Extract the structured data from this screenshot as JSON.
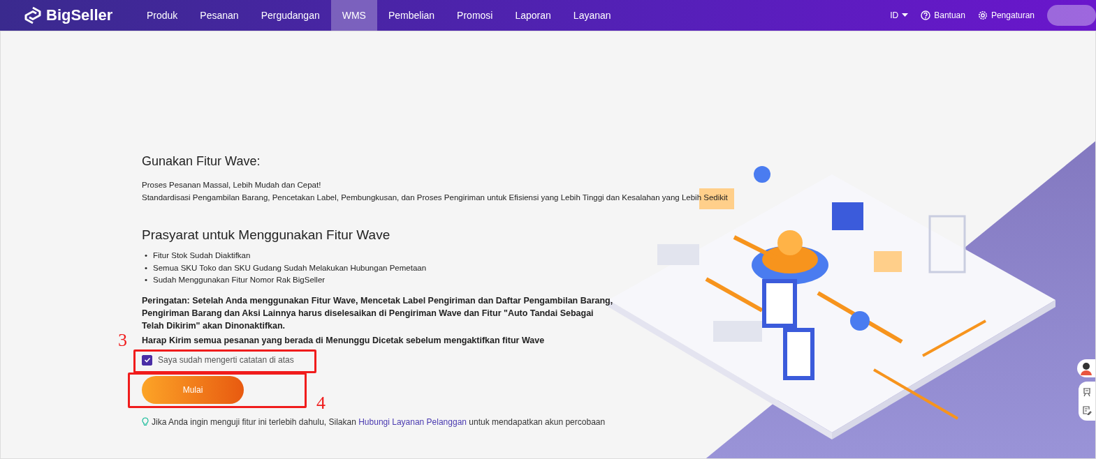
{
  "navbar": {
    "logo": "BigSeller",
    "menu": [
      {
        "label": "Produk",
        "selected": false
      },
      {
        "label": "Pesanan",
        "selected": false
      },
      {
        "label": "Pergudangan",
        "selected": false
      },
      {
        "label": "WMS",
        "selected": true
      },
      {
        "label": "Pembelian",
        "selected": false
      },
      {
        "label": "Promosi",
        "selected": false
      },
      {
        "label": "Laporan",
        "selected": false
      },
      {
        "label": "Layanan",
        "selected": false
      }
    ],
    "language": "ID",
    "help": "Bantuan",
    "settings": "Pengaturan"
  },
  "intro": {
    "title": "Gunakan Fitur Wave:",
    "lines": [
      "Proses Pesanan Massal, Lebih Mudah dan Cepat!",
      "Standardisasi Pengambilan Barang, Pencetakan Label, Pembungkusan, dan Proses Pengiriman untuk Efisiensi yang Lebih Tinggi dan Kesalahan yang Lebih Sedikit"
    ]
  },
  "prerequisites": {
    "title": "Prasyarat untuk Menggunakan Fitur Wave",
    "marker": "•",
    "items": [
      "Fitur Stok Sudah Diaktifkan",
      "Semua SKU Toko dan SKU Gudang Sudah Melakukan Hubungan Pemetaan",
      "Sudah Menggunakan Fitur Nomor Rak BigSeller"
    ]
  },
  "warnings": [
    "Peringatan: Setelah Anda menggunakan Fitur Wave, Mencetak Label Pengiriman dan Daftar Pengambilan Barang, Pengiriman Barang dan Aksi Lainnya harus diselesaikan di Pengiriman Wave dan Fitur \"Auto Tandai Sebagai Telah Dikirim\" akan Dinonaktifkan.",
    "Harap Kirim semua pesanan yang berada di Menunggu Dicetak sebelum mengaktifkan fitur Wave"
  ],
  "agreement": {
    "label": "Saya sudah mengerti catatan di atas",
    "checked": true
  },
  "start_button": "Mulai",
  "tip": {
    "before": "Jika Anda ingin menguji fitur ini terlebih dahulu, Silakan ",
    "link": "Hubungi Layanan Pelanggan",
    "after": " untuk mendapatkan akun percobaan"
  },
  "annotations": [
    {
      "label": "3"
    },
    {
      "label": "4"
    }
  ]
}
